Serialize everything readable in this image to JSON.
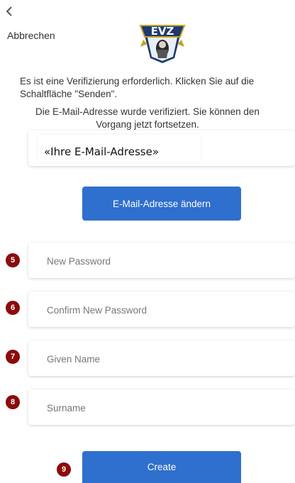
{
  "nav": {
    "back_icon": "chevron-left-icon",
    "cancel_label": "Abbrechen"
  },
  "logo": {
    "text": "EVZ"
  },
  "messages": {
    "verification_required": "Es ist eine Verifizierung erforderlich. Klicken Sie auf die Schaltfläche \"Senden\".",
    "email_verified": "Die E-Mail-Adresse wurde verifiziert. Sie können den Vorgang jetzt fortsetzen."
  },
  "email": {
    "value": "«Ihre E-Mail-Adresse»"
  },
  "change_email_button": "E-Mail-Adresse ändern",
  "fields": {
    "new_password": {
      "placeholder": "New Password",
      "badge": "5"
    },
    "confirm_password": {
      "placeholder": "Confirm New Password",
      "badge": "6"
    },
    "given_name": {
      "placeholder": "Given Name",
      "badge": "7"
    },
    "surname": {
      "placeholder": "Surname",
      "badge": "8"
    }
  },
  "create_button": {
    "label": "Create",
    "badge": "9"
  },
  "colors": {
    "primary_button": "#2f6fce",
    "badge": "#8b0b0b",
    "logo_navy": "#1c3a6e",
    "logo_gold": "#c9a227"
  }
}
